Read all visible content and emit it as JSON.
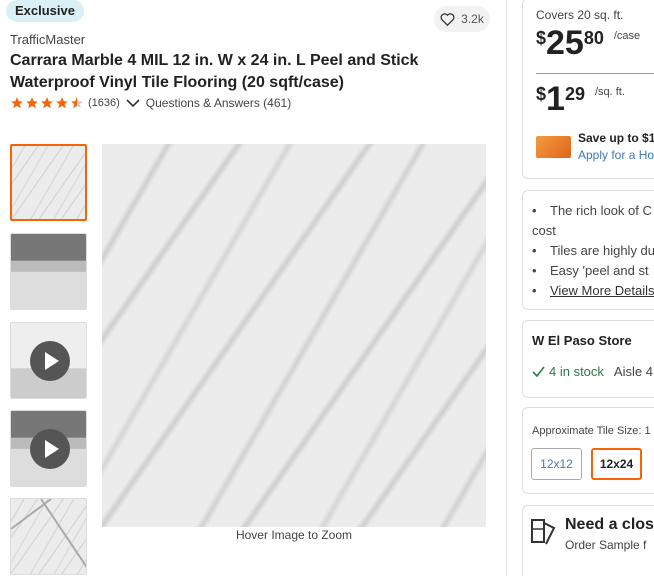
{
  "badge": "Exclusive",
  "favorites": {
    "count": "3.2k"
  },
  "product": {
    "brand": "TrafficMaster",
    "title": "Carrara Marble 4 MIL 12 in. W x 24 in. L Peel and Stick Waterproof Vinyl Tile Flooring (20 sqft/case)",
    "rating": 4.5,
    "review_count": "(1636)",
    "qa_label": "Questions & Answers (461)"
  },
  "gallery": {
    "thumbnails": [
      "marble-swatch",
      "room-scene",
      "video",
      "video",
      "marble-detail"
    ],
    "zoom_hint": "Hover Image to Zoom"
  },
  "pricing": {
    "covers": "Covers 20 sq. ft.",
    "case_price": {
      "currency": "$",
      "dollars": "25",
      "cents": "80",
      "per": "/case"
    },
    "unit_price": {
      "currency": "$",
      "dollars": "1",
      "cents": "29",
      "per": "/sq. ft."
    },
    "promo_line1": "Save up to $1",
    "promo_line2": "Apply for a Ho"
  },
  "highlights": [
    "The rich look of C",
    "cost",
    "Tiles are highly du",
    "Easy 'peel and st"
  ],
  "view_more": "View More Details",
  "store": {
    "name": "W El Paso Store",
    "stock": "4 in stock",
    "aisle": "Aisle 4"
  },
  "tile_size": {
    "label": "Approximate Tile Size: 1",
    "options": [
      "12x12",
      "12x24"
    ],
    "selected": "12x24"
  },
  "sample": {
    "title": "Need a clos",
    "subtitle": "Order Sample f"
  },
  "colors": {
    "accent": "#f96302",
    "link": "#3e7ab8",
    "stock": "#2e7a46",
    "badge": "#d9f0f6"
  }
}
